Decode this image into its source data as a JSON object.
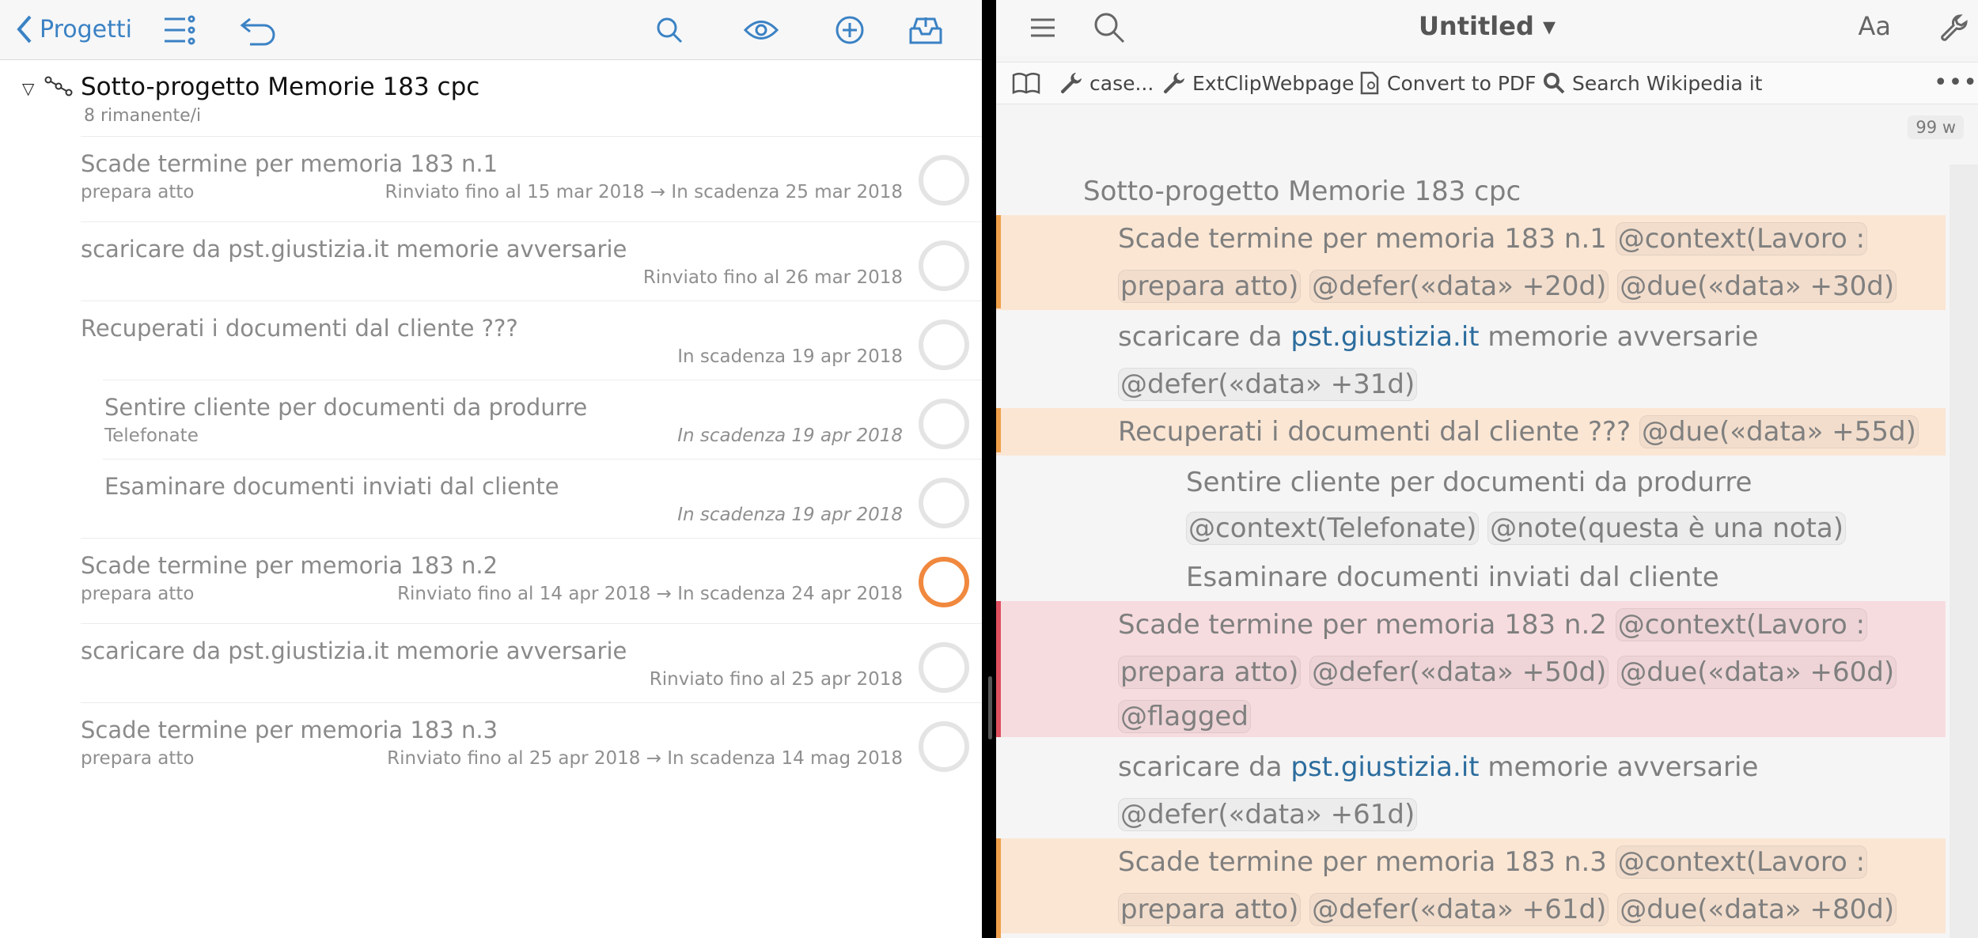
{
  "left": {
    "toolbar": {
      "back_label": "Progetti",
      "icons": [
        "list-icon",
        "undo-icon",
        "search-icon",
        "eye-icon",
        "add-icon",
        "inbox-icon"
      ]
    },
    "project": {
      "title": "Sotto-progetto Memorie 183 cpc",
      "remaining": "8 rimanente/i"
    },
    "tasks": [
      {
        "title": "Scade termine per memoria 183 n.1",
        "context": "prepara atto",
        "dates": "Rinviato fino al 15 mar 2018 → In scadenza 25 mar 2018",
        "flagged": false,
        "indent": false
      },
      {
        "title": "scaricare da pst.giustizia.it  memorie avversarie",
        "context": "",
        "dates": "Rinviato fino al 26 mar 2018",
        "flagged": false,
        "indent": false
      },
      {
        "title": "Recuperati i documenti dal cliente ???",
        "context": "",
        "dates": "In scadenza 19 apr 2018",
        "flagged": false,
        "indent": false
      },
      {
        "title": "Sentire cliente per documenti da produrre",
        "context": "Telefonate",
        "dates": "In scadenza 19 apr 2018",
        "flagged": false,
        "indent": true
      },
      {
        "title": "Esaminare documenti inviati dal cliente",
        "context": "",
        "dates": "In scadenza 19 apr 2018",
        "flagged": false,
        "indent": true
      },
      {
        "title": "Scade termine per memoria 183 n.2",
        "context": "prepara atto",
        "dates": "Rinviato fino al 14 apr 2018 → In scadenza 24 apr 2018",
        "flagged": true,
        "indent": false
      },
      {
        "title": "scaricare da pst.giustizia.it  memorie avversarie",
        "context": "",
        "dates": "Rinviato fino al 25 apr 2018",
        "flagged": false,
        "indent": false
      },
      {
        "title": "Scade termine per memoria 183 n.3",
        "context": "prepara atto",
        "dates": "Rinviato fino al 25 apr 2018 → In scadenza 14 mag 2018",
        "flagged": false,
        "indent": false
      }
    ]
  },
  "right": {
    "title": "Untitled ▾",
    "aa": "Aa",
    "workflows": [
      "case...",
      "ExtClipWebpage",
      "Convert to PDF",
      "Search Wikipedia it"
    ],
    "more": "•••",
    "word_count": "99 w",
    "doc": {
      "l0": "Sotto-progetto Memorie 183 cpc",
      "l1a": "Scade termine per memoria 183 n.1 ",
      "l1b": "@context(Lavoro :",
      "l2a": "prepara atto)",
      "l2b": "@defer(«data» +20d)",
      "l2c": "@due(«data» +30d)",
      "l3a": "scaricare da ",
      "l3link": "pst.giustizia.it",
      "l3b": "  memorie avversarie",
      "l4": "@defer(«data» +31d)",
      "l5a": "Recuperati i documenti dal cliente ??? ",
      "l5b": "@due(«data» +55d)",
      "l6": "Sentire cliente per documenti da produrre",
      "l7a": "@context(Telefonate)",
      "l7b": "@note(questa è una nota)",
      "l8": "Esaminare documenti inviati dal cliente",
      "l9a": "Scade termine per memoria 183 n.2  ",
      "l9b": "@context(Lavoro :",
      "l10a": "prepara atto)",
      "l10b": "@defer(«data» +50d)",
      "l10c": "@due(«data» +60d)",
      "l11": "@flagged",
      "l12a": "scaricare da ",
      "l12link": "pst.giustizia.it",
      "l12b": "  memorie avversarie",
      "l13": "@defer(«data» +61d)",
      "l14a": "Scade termine per memoria 183 n.3  ",
      "l14b": "@context(Lavoro :",
      "l15a": "prepara atto)",
      "l15b": "@defer(«data» +61d)",
      "l15c": "@due(«data» +80d)"
    }
  }
}
